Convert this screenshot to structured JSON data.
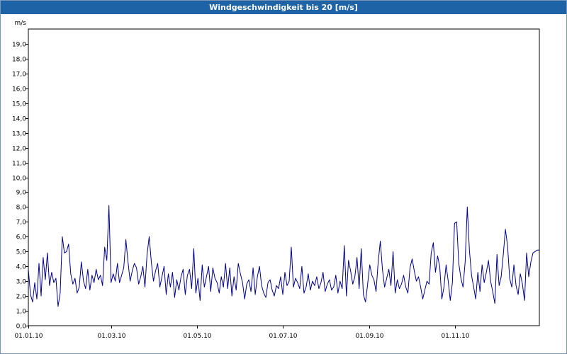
{
  "window": {
    "title": "Windgeschwindigkeit bis 20 [m/s]"
  },
  "chart_data": {
    "type": "line",
    "title": "Windgeschwindigkeit bis 20 [m/s]",
    "ylabel": "m/s",
    "xlabel": "",
    "ylim": [
      0,
      20
    ],
    "y_ticks": [
      "0,0",
      "1,0",
      "2,0",
      "3,0",
      "4,0",
      "5,0",
      "6,0",
      "7,0",
      "8,0",
      "9,0",
      "10,0",
      "11,0",
      "12,0",
      "13,0",
      "14,0",
      "15,0",
      "16,0",
      "17,0",
      "18,0",
      "19,0"
    ],
    "x_ticks": [
      "01.01.10",
      "01.03.10",
      "01.05.10",
      "01.07.10",
      "01.09.10",
      "01.11.10"
    ],
    "x_tick_days": [
      0,
      59,
      120,
      181,
      243,
      304
    ],
    "x_range_days": [
      0,
      364
    ],
    "grid": true,
    "series": [
      {
        "name": "",
        "color": "#00008b",
        "values": [
          3.8,
          2.1,
          1.6,
          2.9,
          1.8,
          4.2,
          2.0,
          4.6,
          3.1,
          4.9,
          2.7,
          3.6,
          2.9,
          3.2,
          1.3,
          2.2,
          6.0,
          4.9,
          5.0,
          5.5,
          3.5,
          2.8,
          3.2,
          2.2,
          2.6,
          4.3,
          3.0,
          2.5,
          3.8,
          2.4,
          3.4,
          2.9,
          3.8,
          3.1,
          3.4,
          2.7,
          5.3,
          4.4,
          8.1,
          2.9,
          3.5,
          3.0,
          4.2,
          2.9,
          3.4,
          3.9,
          5.8,
          4.3,
          3.0,
          3.7,
          4.2,
          3.9,
          2.8,
          3.3,
          4.0,
          2.6,
          4.8,
          6.0,
          4.3,
          3.0,
          3.7,
          4.2,
          2.6,
          3.3,
          4.0,
          2.1,
          3.5,
          2.6,
          3.6,
          1.9,
          3.1,
          2.4,
          3.3,
          3.8,
          2.1,
          3.4,
          3.8,
          2.5,
          5.2,
          2.2,
          3.2,
          1.7,
          4.1,
          2.6,
          3.3,
          4.0,
          2.3,
          3.9,
          3.2,
          2.9,
          2.2,
          3.3,
          2.6,
          4.2,
          2.5,
          3.9,
          2.0,
          3.3,
          2.4,
          4.2,
          3.5,
          2.9,
          1.8,
          2.8,
          3.1,
          2.3,
          3.9,
          2.1,
          3.3,
          4.0,
          2.7,
          2.2,
          1.9,
          2.9,
          3.1,
          2.4,
          2.0,
          2.7,
          2.5,
          3.3,
          2.1,
          3.6,
          2.7,
          3.0,
          5.3,
          2.6,
          3.2,
          2.9,
          2.5,
          4.0,
          2.2,
          2.6,
          3.5,
          2.4,
          3.0,
          2.7,
          3.3,
          2.5,
          2.9,
          3.6,
          2.3,
          2.8,
          3.1,
          2.4,
          2.6,
          3.4,
          2.2,
          3.0,
          2.5,
          5.4,
          2.0,
          4.4,
          3.7,
          2.8,
          3.3,
          4.6,
          2.5,
          5.2,
          2.1,
          1.6,
          2.8,
          4.1,
          3.4,
          3.1,
          2.3,
          4.3,
          5.7,
          3.8,
          2.6,
          3.2,
          3.8,
          2.7,
          5.0,
          2.2,
          3.1,
          2.5,
          2.8,
          3.4,
          2.6,
          2.2,
          3.9,
          4.5,
          3.7,
          3.0,
          3.3,
          2.6,
          1.8,
          2.4,
          3.0,
          2.8,
          4.9,
          5.6,
          3.6,
          4.7,
          4.0,
          1.8,
          2.6,
          4.1,
          3.0,
          1.7,
          2.9,
          6.9,
          7.0,
          4.2,
          3.2,
          2.6,
          4.3,
          8.0,
          5.1,
          3.4,
          2.6,
          1.8,
          3.6,
          2.3,
          4.1,
          2.9,
          3.6,
          4.4,
          3.0,
          2.3,
          1.5,
          4.8,
          2.7,
          3.3,
          4.8,
          6.5,
          5.4,
          3.2,
          2.6,
          4.1,
          2.7,
          2.1,
          3.5,
          2.8,
          1.7,
          4.9,
          3.3,
          4.3,
          4.9,
          5.0,
          5.1,
          5.1
        ]
      }
    ]
  }
}
